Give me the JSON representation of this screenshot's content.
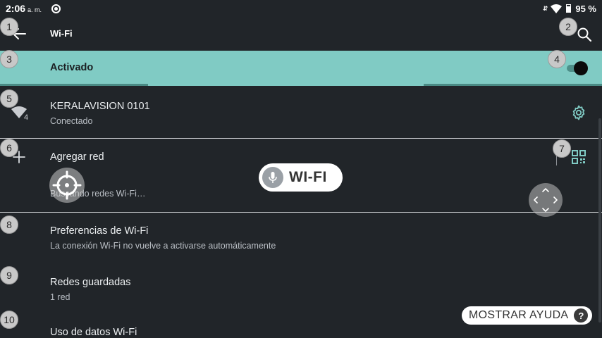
{
  "status_bar": {
    "time": "2:06",
    "ampm": "a. m.",
    "data_arrows": "⇵",
    "battery": "95 %"
  },
  "app_bar": {
    "title": "Wi-Fi"
  },
  "master_switch": {
    "label": "Activado",
    "on": true
  },
  "connected_network": {
    "name": "KERALAVISION 0101",
    "status": "Conectado",
    "wifi_generation": "4"
  },
  "add_network": {
    "label": "Agregar red"
  },
  "scanning": {
    "text": "Buscando redes Wi-Fi…"
  },
  "settings_list": [
    {
      "title": "Preferencias de Wi-Fi",
      "subtitle": "La conexión Wi-Fi no vuelve a activarse automáticamente"
    },
    {
      "title": "Redes guardadas",
      "subtitle": "1 red"
    },
    {
      "title": "Uso de datos Wi-Fi",
      "subtitle": ""
    }
  ],
  "voice_overlay": {
    "label": "WI-FI"
  },
  "help_button": {
    "label": "MOSTRAR AYUDA",
    "icon_text": "?"
  },
  "overlay_badges": [
    "1",
    "2",
    "3",
    "4",
    "5",
    "6",
    "7",
    "8",
    "9",
    "10"
  ],
  "colors": {
    "background": "#212529",
    "accent": "#80cbc4",
    "icon_accent": "#80cbc4"
  }
}
